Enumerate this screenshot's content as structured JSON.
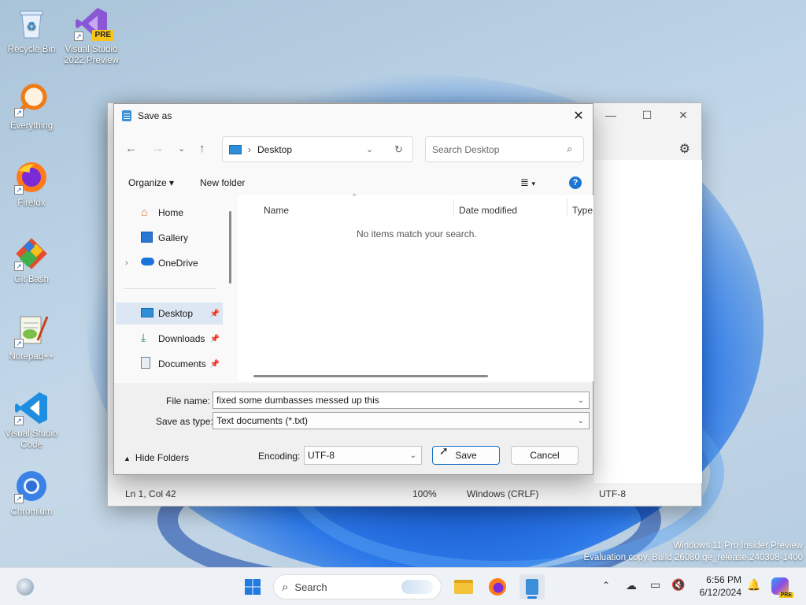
{
  "desktop": {
    "icons": [
      {
        "label": "Recycle Bin"
      },
      {
        "label": "Visual Studio 2022 Preview",
        "badge": "PRE"
      },
      {
        "label": "Everything"
      },
      {
        "label": "Firefox"
      },
      {
        "label": "Git Bash"
      },
      {
        "label": "Notepad++"
      },
      {
        "label": "Visual Studio Code"
      },
      {
        "label": "Chromium"
      }
    ],
    "watermark": {
      "line1": "Windows 11 Pro Insider Preview",
      "line2": "Evaluation copy. Build 26080.ge_release.240308-1400"
    }
  },
  "notepad": {
    "status": {
      "position": "Ln 1, Col 42",
      "zoom": "100%",
      "line_endings": "Windows (CRLF)",
      "encoding": "UTF-8"
    }
  },
  "dialog": {
    "title": "Save as",
    "address": {
      "location": "Desktop"
    },
    "search": {
      "placeholder": "Search Desktop"
    },
    "toolbar": {
      "organize": "Organize",
      "new_folder": "New folder"
    },
    "sidebar": {
      "items": [
        {
          "label": "Home"
        },
        {
          "label": "Gallery"
        },
        {
          "label": "OneDrive"
        },
        {
          "label": "Desktop"
        },
        {
          "label": "Downloads"
        },
        {
          "label": "Documents"
        }
      ]
    },
    "columns": {
      "name": "Name",
      "date": "Date modified",
      "type": "Type"
    },
    "empty_message": "No items match your search.",
    "form": {
      "filename_label": "File name:",
      "filename_value": "fixed some dumbasses messed up this",
      "savetype_label": "Save as type:",
      "savetype_value": "Text documents (*.txt)",
      "hide_folders": "Hide Folders",
      "encoding_label": "Encoding:",
      "encoding_value": "UTF-8",
      "save": "Save",
      "cancel": "Cancel"
    }
  },
  "taskbar": {
    "search_placeholder": "Search",
    "time": "6:56 PM",
    "date": "6/12/2024",
    "copilot_badge": "PRE"
  }
}
